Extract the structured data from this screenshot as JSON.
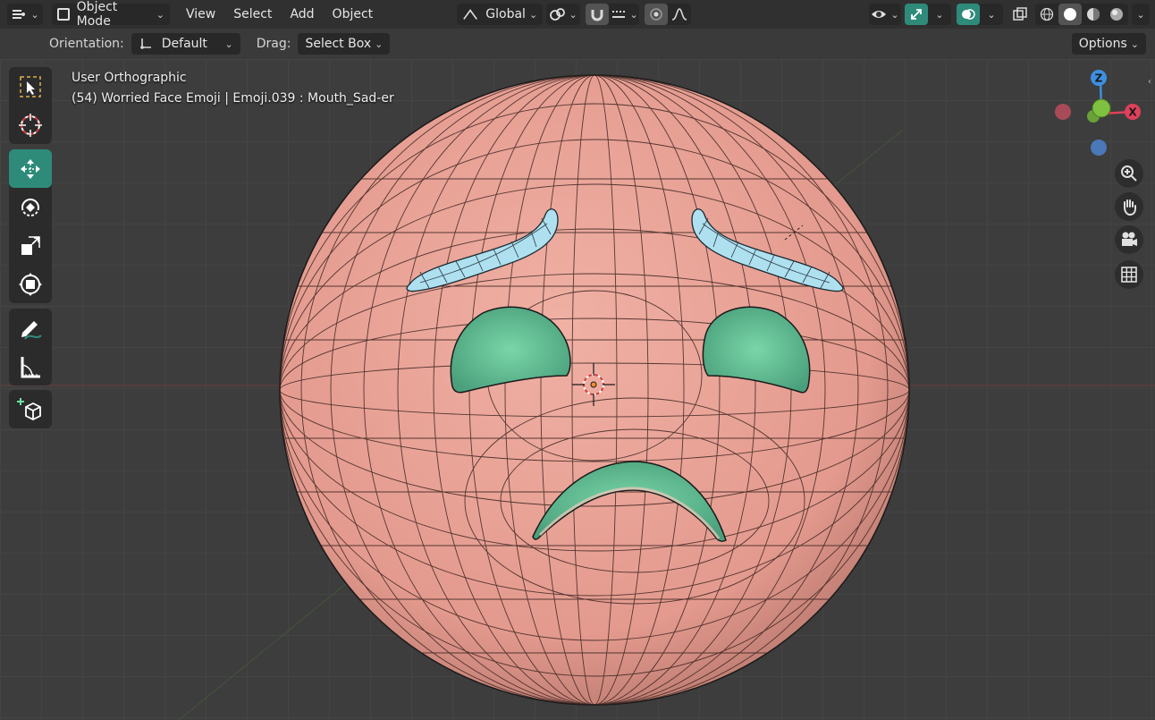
{
  "header": {
    "mode_label": "Object Mode",
    "menus": [
      "View",
      "Select",
      "Add",
      "Object"
    ],
    "transform_orientation": "Global"
  },
  "tool_settings": {
    "orientation_label": "Orientation:",
    "orientation_value": "Default",
    "drag_label": "Drag:",
    "drag_value": "Select Box",
    "options_label": "Options"
  },
  "viewport": {
    "view_name": "User Orthographic",
    "object_info": "(54) Worried Face Emoji | Emoji.039 : Mouth_Sad-er"
  },
  "gizmo": {
    "axes": [
      "Z",
      "X"
    ],
    "colors": {
      "x": "#e0405a",
      "y": "#7fc040",
      "z": "#3d8fe0"
    }
  },
  "toolbox": {
    "tools": [
      "select-box",
      "cursor",
      "move",
      "rotate",
      "scale",
      "transform",
      "annotate",
      "measure",
      "add-cube"
    ],
    "active": "move"
  },
  "colors": {
    "face": "#e8a498",
    "brows": "#aee0f0",
    "holes": "#6fcfa0",
    "accent_teal": "#2e8b7a"
  }
}
